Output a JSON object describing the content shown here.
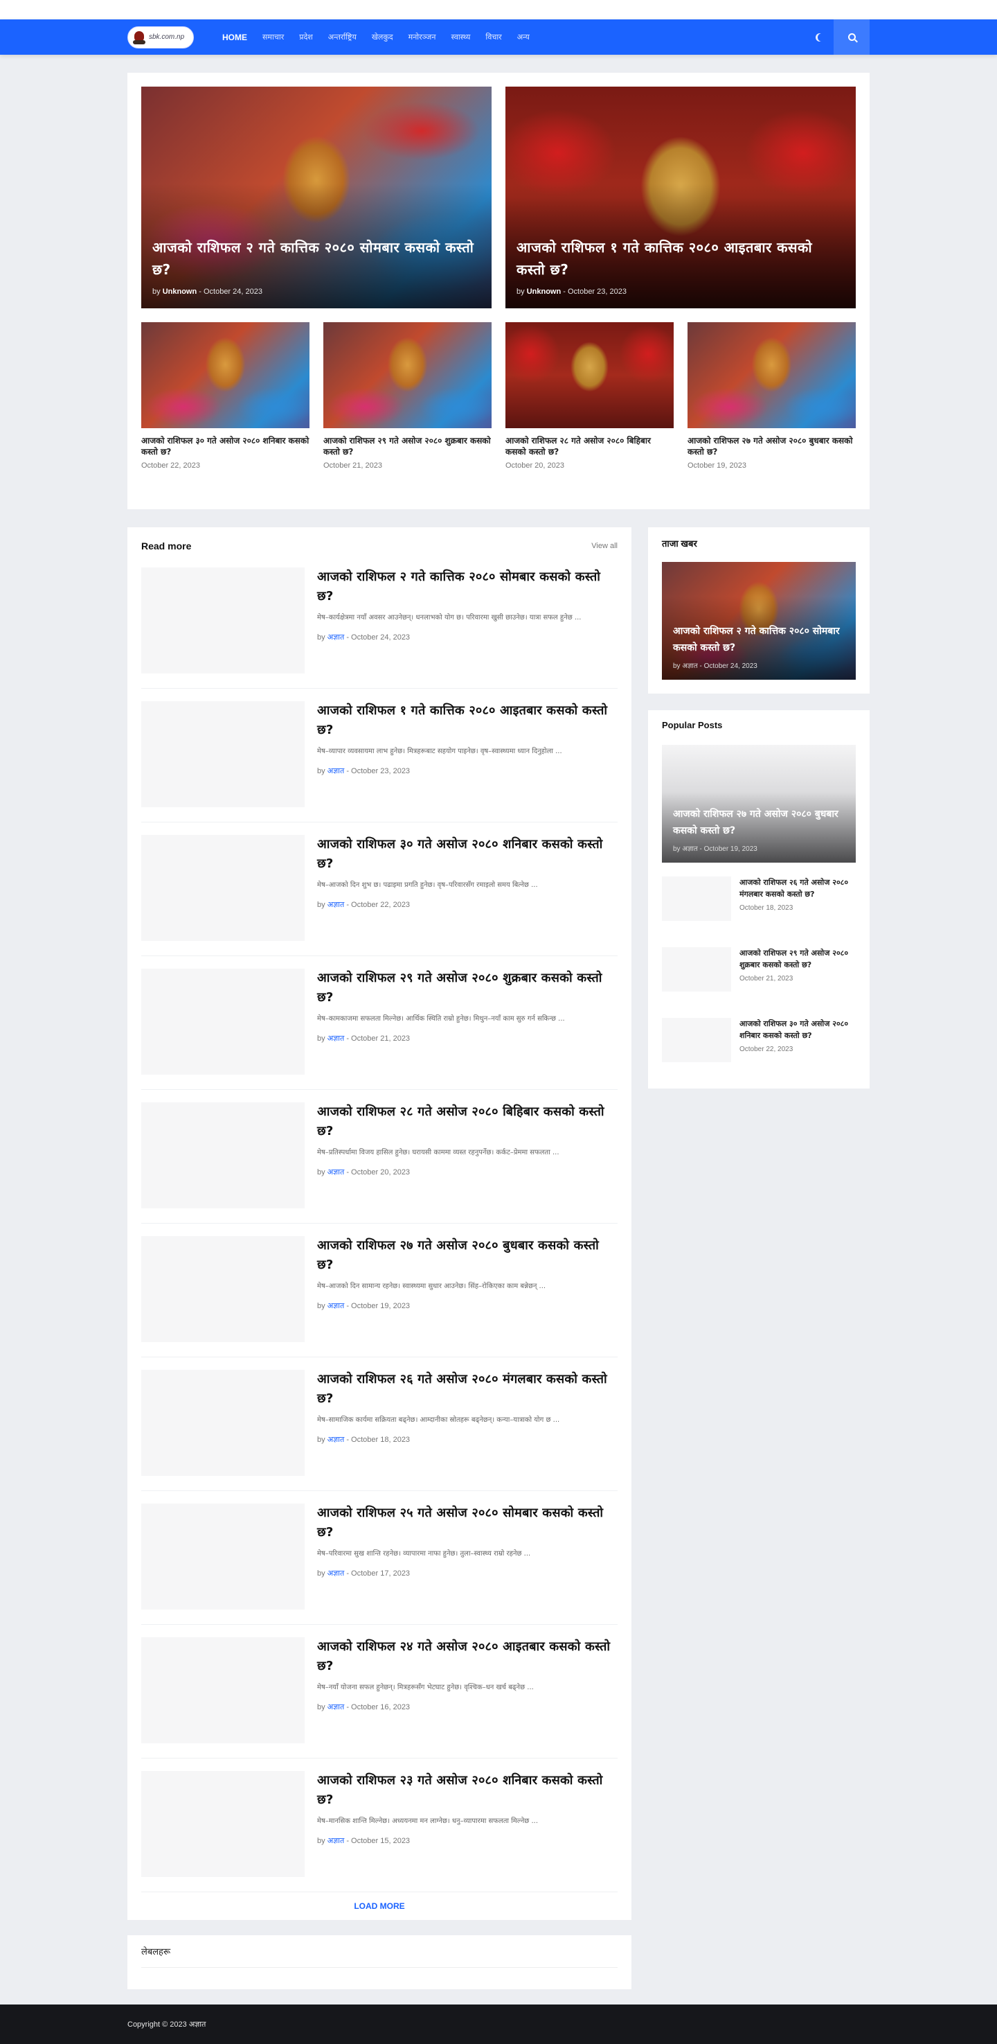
{
  "nav": {
    "logo_text": "sbk.com.np",
    "items": [
      "HOME",
      "समाचार",
      "प्रदेश",
      "अन्तर्राष्ट्रिय",
      "खेलकुद",
      "मनोरञ्जन",
      "स्वास्थ्य",
      "विचार",
      "अन्य"
    ]
  },
  "featured": {
    "big": [
      {
        "title": "आजको राशिफल २ गते कात्तिक २०८० सोमबार कसको कस्तो छ?",
        "by": "by",
        "author": "Unknown",
        "date": "October 24, 2023"
      },
      {
        "title": "आजको राशिफल १ गते कात्तिक २०८० आइतबार कसको कस्तो छ?",
        "by": "by",
        "author": "Unknown",
        "date": "October 23, 2023"
      }
    ],
    "small": [
      {
        "title": "आजको राशिफल ३० गते असोज २०८० शनिबार कसको कस्तो छ?",
        "date": "October 22, 2023"
      },
      {
        "title": "आजको राशिफल २९ गते असोज २०८० शुक्रबार कसको कस्तो छ?",
        "date": "October 21, 2023"
      },
      {
        "title": "आजको राशिफल २८ गते असोज २०८० बिहिबार कसको कस्तो छ?",
        "date": "October 20, 2023"
      },
      {
        "title": "आजको राशिफल २७ गते असोज २०८० बुधबार कसको कस्तो छ?",
        "date": "October 19, 2023"
      }
    ]
  },
  "read_more": {
    "title": "Read more",
    "view_all": "View all",
    "posts": [
      {
        "title": "आजको राशिफल २ गते कात्तिक २०८० सोमबार कसको कस्तो छ?",
        "excerpt": "मेष–कार्यक्षेत्रमा नयाँ अवसर आउनेछन्। धनलाभको योग छ। परिवारमा खुसी छाउनेछ। यात्रा सफल हुनेछ ...",
        "by": "by",
        "author": "अज्ञात",
        "date": "October 24, 2023"
      },
      {
        "title": "आजको राशिफल १ गते कात्तिक २०८० आइतबार कसको कस्तो छ?",
        "excerpt": "मेष–व्यापार व्यवसायमा लाभ हुनेछ। मित्रहरूबाट सहयोग पाइनेछ। वृष–स्वास्थ्यमा ध्यान दिनुहोला ...",
        "by": "by",
        "author": "अज्ञात",
        "date": "October 23, 2023"
      },
      {
        "title": "आजको राशिफल ३० गते असोज २०८० शनिबार कसको कस्तो छ?",
        "excerpt": "मेष–आजको दिन शुभ छ। पढाइमा प्रगति हुनेछ। वृष–परिवारसँग रमाइलो समय बित्नेछ ...",
        "by": "by",
        "author": "अज्ञात",
        "date": "October 22, 2023"
      },
      {
        "title": "आजको राशिफल २९ गते असोज २०८० शुक्रबार कसको कस्तो छ?",
        "excerpt": "मेष–कामकाजमा सफलता मिल्नेछ। आर्थिक स्थिति राम्रो हुनेछ। मिथुन–नयाँ काम सुरु गर्न सकिन्छ ...",
        "by": "by",
        "author": "अज्ञात",
        "date": "October 21, 2023"
      },
      {
        "title": "आजको राशिफल २८ गते असोज २०८० बिहिबार कसको कस्तो छ?",
        "excerpt": "मेष–प्रतिस्पर्धामा विजय हासिल हुनेछ। घरायसी काममा व्यस्त रहनुपर्नेछ। कर्कट–प्रेममा सफलता ...",
        "by": "by",
        "author": "अज्ञात",
        "date": "October 20, 2023"
      },
      {
        "title": "आजको राशिफल २७ गते असोज २०८० बुधबार कसको कस्तो छ?",
        "excerpt": "मेष–आजको दिन सामान्य रहनेछ। स्वास्थ्यमा सुधार आउनेछ। सिंह–रोकिएका काम बन्नेछन् ...",
        "by": "by",
        "author": "अज्ञात",
        "date": "October 19, 2023"
      },
      {
        "title": "आजको राशिफल २६ गते असोज २०८० मंगलबार कसको कस्तो छ?",
        "excerpt": "मेष–सामाजिक कार्यमा सक्रियता बढ्नेछ। आम्दानीका स्रोतहरू बढ्नेछन्। कन्या–यात्राको योग छ ...",
        "by": "by",
        "author": "अज्ञात",
        "date": "October 18, 2023"
      },
      {
        "title": "आजको राशिफल २५ गते असोज २०८० सोमबार कसको कस्तो छ?",
        "excerpt": "मेष–परिवारमा सुख शान्ति रहनेछ। व्यापारमा नाफा हुनेछ। तुला–स्वास्थ्य राम्रो रहनेछ ...",
        "by": "by",
        "author": "अज्ञात",
        "date": "October 17, 2023"
      },
      {
        "title": "आजको राशिफल २४ गते असोज २०८० आइतबार कसको कस्तो छ?",
        "excerpt": "मेष–नयाँ योजना सफल हुनेछन्। मित्रहरूसँग भेटघाट हुनेछ। वृश्चिक–धन खर्च बढ्नेछ ...",
        "by": "by",
        "author": "अज्ञात",
        "date": "October 16, 2023"
      },
      {
        "title": "आजको राशिफल २३ गते असोज २०८० शनिबार कसको कस्तो छ?",
        "excerpt": "मेष–मानसिक शान्ति मिल्नेछ। अध्ययनमा मन लाग्नेछ। धनु–व्यापारमा सफलता मिल्नेछ ...",
        "by": "by",
        "author": "अज्ञात",
        "date": "October 15, 2023"
      }
    ],
    "load_more": "LOAD MORE"
  },
  "label_panel": {
    "title": "लेबलहरू"
  },
  "sidebar": {
    "widget1": {
      "title": "ताजा खबर",
      "post": {
        "title": "आजको राशिफल २ गते कात्तिक २०८० सोमबार कसको कस्तो छ?",
        "by": "by",
        "author": "अज्ञात",
        "date": "October 24, 2023"
      }
    },
    "popular": {
      "title": "Popular Posts",
      "hero": {
        "title": "आजको राशिफल २७ गते असोज २०८० बुधबार कसको कस्तो छ?",
        "by": "by",
        "author": "अज्ञात",
        "date": "October 19, 2023"
      },
      "items": [
        {
          "title": "आजको राशिफल २६ गते असोज २०८० मंगलबार कसको कस्तो छ?",
          "date": "October 18, 2023"
        },
        {
          "title": "आजको राशिफल २९ गते असोज २०८० शुक्रबार कसको कस्तो छ?",
          "date": "October 21, 2023"
        },
        {
          "title": "आजको राशिफल ३० गते असोज २०८० शनिबार कसको कस्तो छ?",
          "date": "October 22, 2023"
        }
      ]
    }
  },
  "footer": {
    "text": "Copyright © 2023 अज्ञात"
  },
  "colors": {
    "brand": "#1b63ff",
    "footer": "#16171b",
    "background": "#eceef2"
  }
}
